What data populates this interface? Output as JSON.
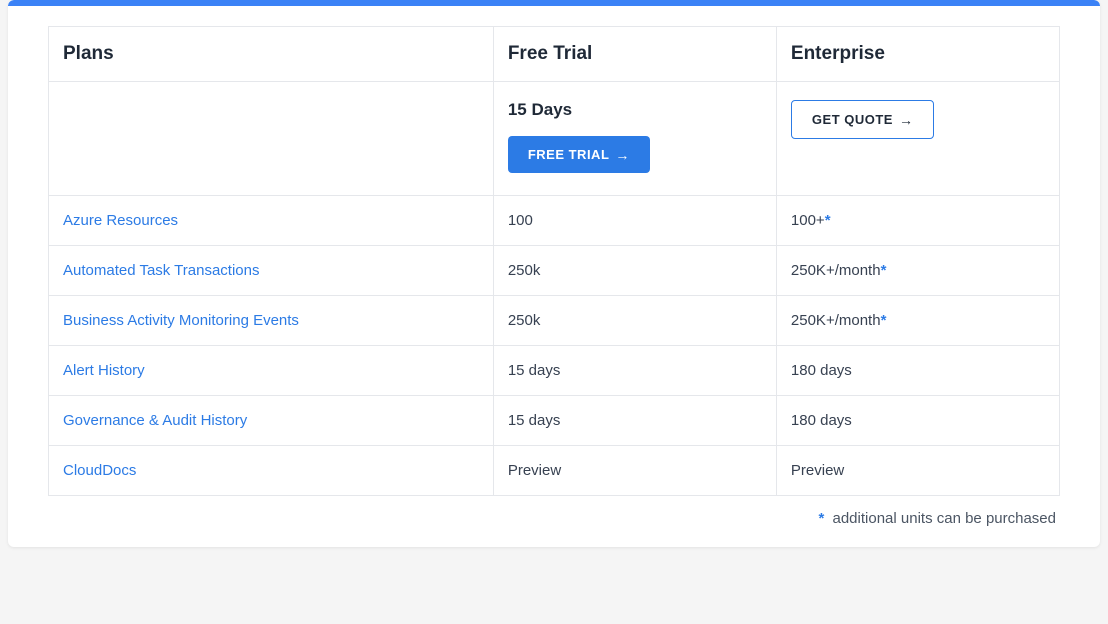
{
  "headers": {
    "plans": "Plans",
    "trial": "Free Trial",
    "enterprise": "Enterprise"
  },
  "cta": {
    "trial_days": "15 Days",
    "trial_button": "FREE TRIAL",
    "enterprise_button": "GET QUOTE"
  },
  "rows": [
    {
      "feature": "Azure Resources",
      "trial": "100",
      "enterprise": "100+",
      "ent_asterisk": true
    },
    {
      "feature": "Automated Task Transactions",
      "trial": "250k",
      "enterprise": "250K+/month",
      "ent_asterisk": true
    },
    {
      "feature": "Business Activity Monitoring Events",
      "trial": "250k",
      "enterprise": "250K+/month",
      "ent_asterisk": true
    },
    {
      "feature": "Alert History",
      "trial": "15 days",
      "enterprise": "180 days",
      "ent_asterisk": false
    },
    {
      "feature": "Governance & Audit History",
      "trial": "15 days",
      "enterprise": "180 days",
      "ent_asterisk": false
    },
    {
      "feature": "CloudDocs",
      "trial": "Preview",
      "enterprise": "Preview",
      "ent_asterisk": false
    }
  ],
  "footnote": {
    "marker": "*",
    "text": "additional units can be purchased"
  }
}
